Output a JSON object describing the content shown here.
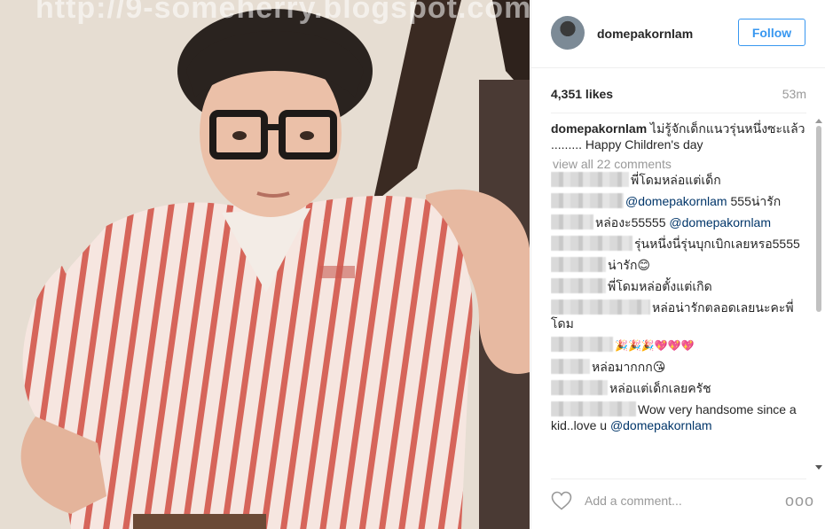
{
  "photo": {
    "watermark": "http://9-someherry.blogspot.com/"
  },
  "header": {
    "avatar_icon": "profile-avatar",
    "username": "domepakornlam",
    "follow_label": "Follow"
  },
  "stats": {
    "likes": "4,351 likes",
    "time": "53m"
  },
  "caption": {
    "username": "domepakornlam",
    "text": "ไม่รู้จักเด็กแนวรุ่นหนึ่งซะแล้ว ......... Happy Children's day"
  },
  "view_all": "view all 22 comments",
  "comments": [
    {
      "text": "พี่โดมหล่อแต่เด็ก",
      "mention": ""
    },
    {
      "text": "",
      "mention": "@domepakornlam",
      "suffix": " 555น่ารัก"
    },
    {
      "text": "หล่องะ55555 ",
      "mention": "@domepakornlam"
    },
    {
      "text": "รุ่นหนึ่งนี่รุ่นบุกเบิกเลยหรอ5555",
      "mention": ""
    },
    {
      "text": "น่ารัก😊",
      "mention": ""
    },
    {
      "text": "พี่โดมหล่อตั้งแต่เกิด",
      "mention": ""
    },
    {
      "text": "หล่อน่ารักตลอดเลยนะคะพี่โดม",
      "mention": ""
    },
    {
      "text": "🎉🎉🎉💖💖💖",
      "mention": ""
    },
    {
      "text": "หล่อมากกก😘",
      "mention": ""
    },
    {
      "text": "หล่อแต่เด็กเลยครัช",
      "mention": ""
    },
    {
      "text": "Wow very handsome since a kid..love u ",
      "mention": "@domepakornlam"
    }
  ],
  "footer": {
    "heart_icon": "heart-icon",
    "add_comment_placeholder": "Add a comment...",
    "more_icon": "more-options-icon",
    "more_label": "ooo"
  },
  "colors": {
    "accent": "#3897f0",
    "mention": "#003569",
    "muted": "#999999",
    "text": "#262626"
  }
}
